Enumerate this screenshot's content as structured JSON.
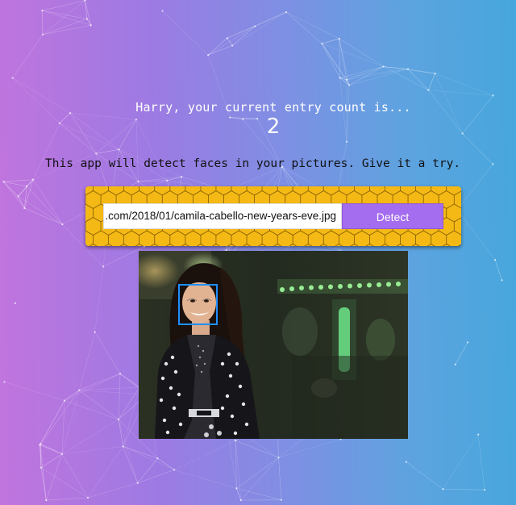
{
  "rank": {
    "message": "Harry, your current entry count is...",
    "count": "2"
  },
  "intro": {
    "text": "This app will detect faces in your pictures. Give it a try."
  },
  "form": {
    "input_value": ".com/2018/01/camila-cabello-new-years-eve.jpg",
    "detect_label": "Detect"
  },
  "result": {
    "faces_detected": 1
  },
  "colors": {
    "panel": "#f5b915",
    "button": "#a46cee",
    "face_box": "#1e90ff"
  }
}
